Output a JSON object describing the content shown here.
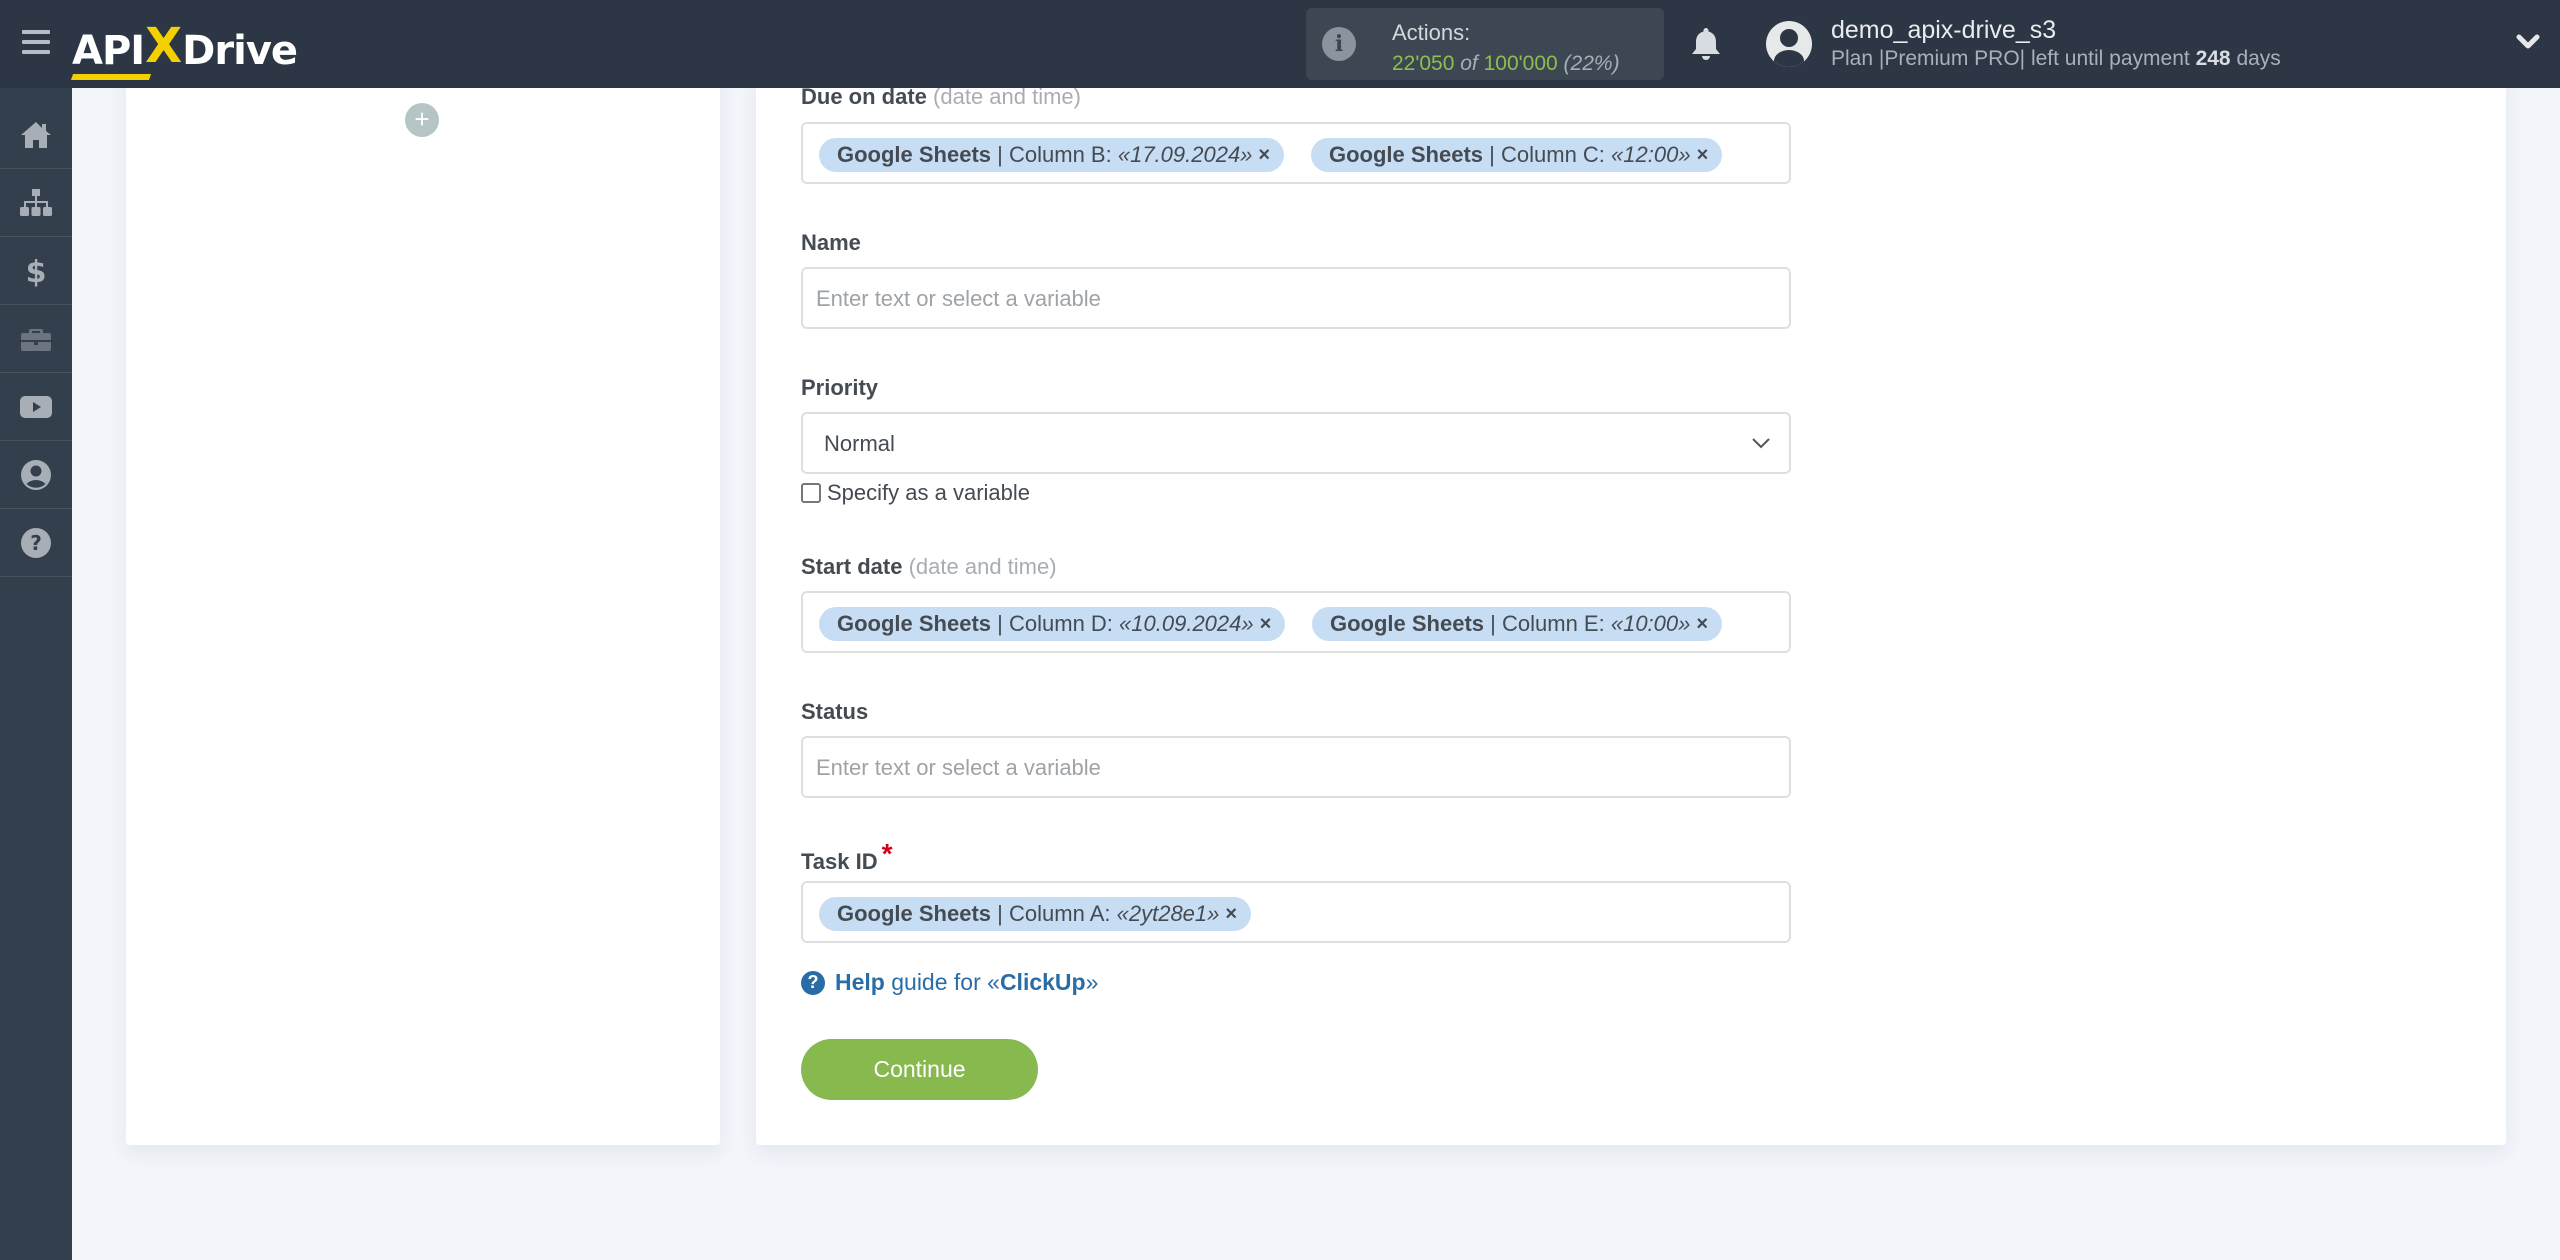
{
  "header": {
    "logo": {
      "left": "API",
      "x": "X",
      "right": "Drive"
    },
    "actions": {
      "label": "Actions:",
      "used": "22'050",
      "of": "of",
      "total": "100'000",
      "percent": "(22%)",
      "progress_percent": 22
    },
    "user": {
      "name": "demo_apix-drive_s3",
      "plan_prefix": "Plan |Premium PRO| left until payment",
      "days": "248",
      "days_suffix": "days"
    }
  },
  "sidebar": {
    "items": [
      {
        "icon": "home-icon",
        "label": "Home"
      },
      {
        "icon": "sitemap-icon",
        "label": "Connections"
      },
      {
        "icon": "dollar-icon",
        "label": "Billing"
      },
      {
        "icon": "briefcase-icon",
        "label": "Tools"
      },
      {
        "icon": "youtube-icon",
        "label": "Video"
      },
      {
        "icon": "user-circle-icon",
        "label": "Account"
      },
      {
        "icon": "question-circle-icon",
        "label": "Help"
      }
    ]
  },
  "form": {
    "due_date": {
      "label": "Due on date",
      "hint": "(date and time)",
      "tags": [
        {
          "source": "Google Sheets",
          "column": "| Column B:",
          "value": "«17.09.2024»",
          "remove": "×"
        },
        {
          "source": "Google Sheets",
          "column": "| Column C:",
          "value": "«12:00»",
          "remove": "×"
        }
      ]
    },
    "name": {
      "label": "Name",
      "placeholder": "Enter text or select a variable"
    },
    "priority": {
      "label": "Priority",
      "value": "Normal",
      "checkbox_label": "Specify as a variable",
      "checkbox_checked": false
    },
    "start_date": {
      "label": "Start date",
      "hint": "(date and time)",
      "tags": [
        {
          "source": "Google Sheets",
          "column": "| Column D:",
          "value": "«10.09.2024»",
          "remove": "×"
        },
        {
          "source": "Google Sheets",
          "column": "| Column E:",
          "value": "«10:00»",
          "remove": "×"
        }
      ]
    },
    "status": {
      "label": "Status",
      "placeholder": "Enter text or select a variable"
    },
    "task_id": {
      "label": "Task ID",
      "required_mark": "*",
      "tags": [
        {
          "source": "Google Sheets",
          "column": "| Column A:",
          "value": "«2yt28e1»",
          "remove": "×"
        }
      ]
    },
    "help": {
      "help_word": "Help",
      "middle": "guide for «",
      "service": "ClickUp",
      "end": "»"
    },
    "continue_label": "Continue"
  },
  "left_panel": {
    "add_label": "+"
  }
}
